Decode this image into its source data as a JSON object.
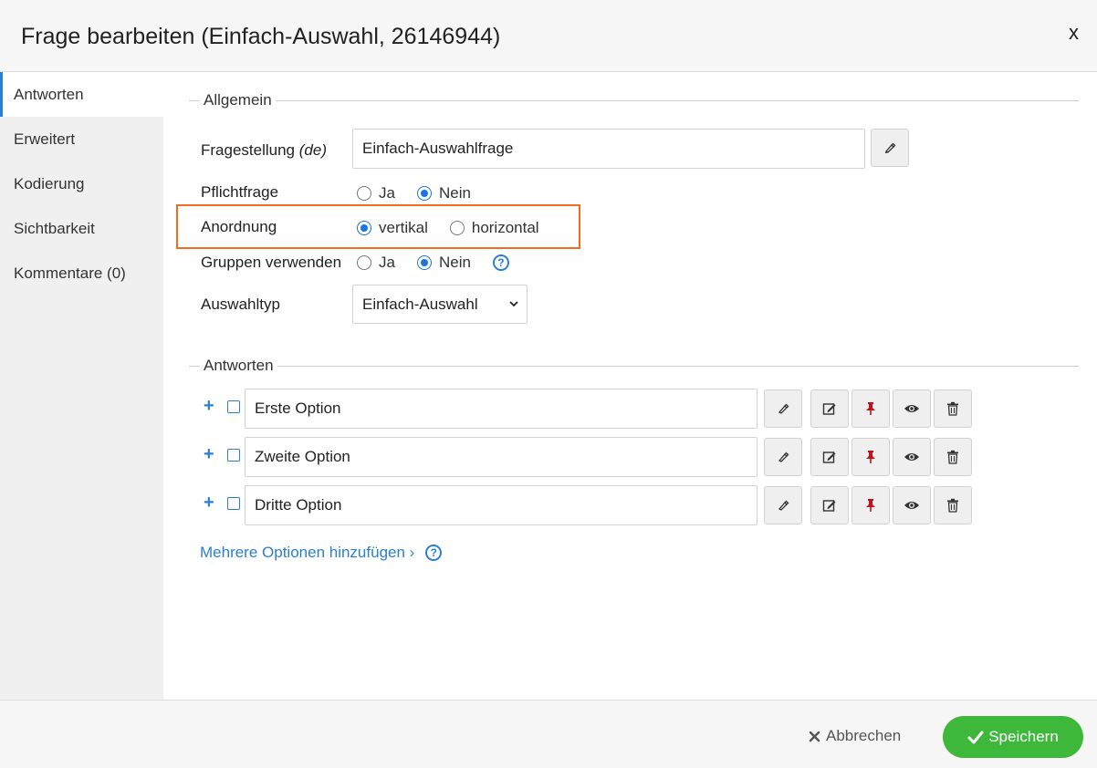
{
  "header": {
    "title": "Frage bearbeiten (Einfach-Auswahl, 26146944)",
    "close_label": "x"
  },
  "sidebar": {
    "items": [
      {
        "label": "Antworten",
        "active": true
      },
      {
        "label": "Erweitert"
      },
      {
        "label": "Kodierung"
      },
      {
        "label": "Sichtbarkeit"
      },
      {
        "label": "Kommentare (0)"
      }
    ]
  },
  "general": {
    "legend": "Allgemein",
    "question_label": "Fragestellung",
    "question_lang": "(de)",
    "question_value": "Einfach-Auswahlfrage",
    "mandatory_label": "Pflichtfrage",
    "mandatory_options": [
      "Ja",
      "Nein"
    ],
    "mandatory_selected": "Nein",
    "arrangement_label": "Anordnung",
    "arrangement_options": [
      "vertikal",
      "horizontal"
    ],
    "arrangement_selected": "vertikal",
    "groups_label": "Gruppen verwenden",
    "groups_options": [
      "Ja",
      "Nein"
    ],
    "groups_selected": "Nein",
    "selection_type_label": "Auswahltyp",
    "selection_type_value": "Einfach-Auswahl"
  },
  "answers": {
    "legend": "Antworten",
    "options": [
      {
        "value": "Erste Option"
      },
      {
        "value": "Zweite Option"
      },
      {
        "value": "Dritte Option"
      }
    ],
    "add_multiple_label": "Mehrere Optionen hinzufügen ›"
  },
  "footer": {
    "cancel_label": "Abbrechen",
    "save_label": "Speichern"
  },
  "colors": {
    "accent": "#2a7fd4",
    "highlight": "#f26b21",
    "save": "#3db83b",
    "pin": "#c0141b"
  }
}
